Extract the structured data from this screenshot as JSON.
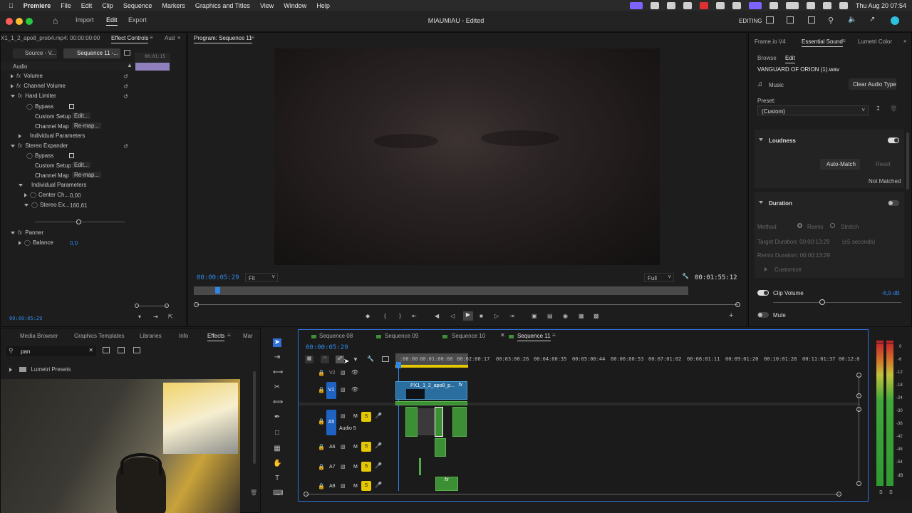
{
  "menubar": {
    "app": "Premiere",
    "items": [
      "File",
      "Edit",
      "Clip",
      "Sequence",
      "Markers",
      "Graphics and Titles",
      "View",
      "Window",
      "Help"
    ],
    "datetime": "Thu Aug 20  07:54"
  },
  "titlebar": {
    "tabs": [
      "Import",
      "Edit",
      "Export"
    ],
    "active_tab": "Edit",
    "doc_title": "MIAUMIAU - Edited",
    "workspace": "EDITING"
  },
  "effect_controls": {
    "tabs": [
      "X1_1_2_apo8_prob4.mp4: 00:00:00:00",
      "Effect Controls",
      "Aud"
    ],
    "source_btn": "Source - V...",
    "seq_btn": "Sequence 11 -...",
    "mini_timecode": "00:01:15",
    "section": "Audio",
    "rows": {
      "volume": "Volume",
      "channel_volume": "Channel Volume",
      "hard_limiter": "Hard Limiter",
      "bypass": "Bypass",
      "custom_setup": "Custom Setup",
      "edit": "Edit...",
      "channel_map": "Channel Map",
      "remap": "Re-map...",
      "individual_parameters": "Individual Parameters",
      "stereo_expander": "Stereo Expander",
      "center_ch": "Center Ch...",
      "center_ch_val": "0,00",
      "stereo_ex": "Stereo Ex...",
      "stereo_ex_val": "160,61",
      "panner": "Panner",
      "balance": "Balance",
      "balance_val": "0,0"
    },
    "timecode": "00:00:05:29"
  },
  "program": {
    "title": "Program: Sequence 11",
    "timecode": "00:00:05:29",
    "fit": "Fit",
    "quality": "Full",
    "duration": "00:01:55:12"
  },
  "essential_sound": {
    "tabs": [
      "Frame.io V4",
      "Essential Sound",
      "Lumetri Color"
    ],
    "subtabs": [
      "Browse",
      "Edit"
    ],
    "clip_name": "VANGUARD OF ORION (1).wav",
    "type": "Music",
    "clear_btn": "Clear Audio Type",
    "preset_label": "Preset:",
    "preset_value": "(Custom)",
    "loudness": "Loudness",
    "auto_match": "Auto-Match",
    "reset": "Reset",
    "not_matched": "Not Matched",
    "duration": "Duration",
    "method_label": "Method",
    "remix": "Remix",
    "stretch": "Stretch",
    "target_duration": "Target Duration: 00:00:13:29",
    "target_note": "(±5 seconds)",
    "remix_duration": "Remix Duration: 00:00:13:29",
    "customize": "Customize",
    "clip_volume": "Clip Volume",
    "clip_volume_val": "-6,9 dB",
    "mute": "Mute"
  },
  "browser_panel": {
    "tabs": [
      "Media Browser",
      "Graphics Templates",
      "Libraries",
      "Info",
      "Effects",
      "Mar"
    ],
    "search_value": "pan",
    "lumetri": "Lumetri Presets"
  },
  "timeline": {
    "tabs": [
      "Sequence 08",
      "Sequence 09",
      "Sequence 10",
      "Sequence 11"
    ],
    "timecode": "00:00:05:29",
    "ruler": [
      ":00:00",
      "00:01:00:08",
      "00:02:00:17",
      "00:03:00:26",
      "00:04:00:35",
      "00:05:00:44",
      "00:06:00:53",
      "00:07:01:02",
      "00:08:01:11",
      "00:09:01:20",
      "00:10:01:28",
      "00:11:01:37",
      "00:12:0"
    ],
    "v1": "V1",
    "v2": "V2",
    "a5": "A5",
    "a5_name": "Audio 5",
    "a6": "A6",
    "a7": "A7",
    "a8": "A8",
    "m": "M",
    "s": "S",
    "clip_name": "PX1_1_2_apo8_p...",
    "fx": "fx"
  },
  "meter": {
    "ticks": [
      "0",
      "-6",
      "-12",
      "-18",
      "-24",
      "-30",
      "-36",
      "-42",
      "-48",
      "-54",
      "dB"
    ],
    "solo": [
      "S",
      "S"
    ]
  }
}
